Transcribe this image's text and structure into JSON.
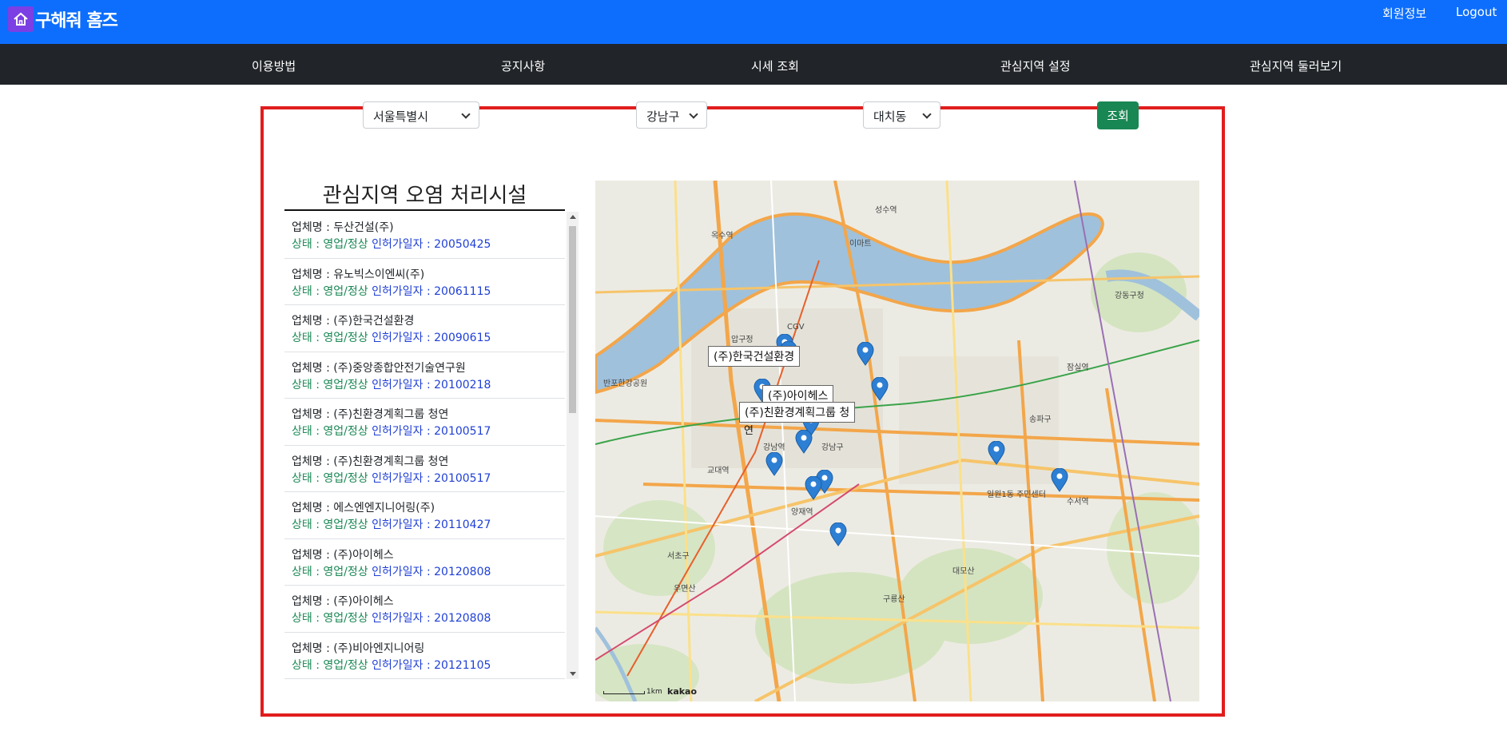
{
  "header": {
    "logo_text": "구해줘 홈즈",
    "member_label": "회원정보",
    "logout_label": "Logout"
  },
  "nav": {
    "items": [
      {
        "label": "이용방법"
      },
      {
        "label": "공지사항"
      },
      {
        "label": "시세 조회"
      },
      {
        "label": "관심지역 설정"
      },
      {
        "label": "관심지역 둘러보기"
      }
    ]
  },
  "filters": {
    "city": "서울특별시",
    "district": "강남구",
    "dong": "대치동",
    "search_label": "조회"
  },
  "list": {
    "title": "관심지역 오염 처리시설",
    "name_prefix": "업체명 : ",
    "status_prefix": "상태 : ",
    "date_prefix": "인허가일자 : ",
    "items": [
      {
        "name": "두산건설(주)",
        "status": "영업/정상",
        "date": "20050425"
      },
      {
        "name": "유노빅스이엔씨(주)",
        "status": "영업/정상",
        "date": "20061115"
      },
      {
        "name": "(주)한국건설환경",
        "status": "영업/정상",
        "date": "20090615"
      },
      {
        "name": "(주)중앙종합안전기술연구원",
        "status": "영업/정상",
        "date": "20100218"
      },
      {
        "name": "(주)친환경계획그룹 청연",
        "status": "영업/정상",
        "date": "20100517"
      },
      {
        "name": "(주)친환경계획그룹 청연",
        "status": "영업/정상",
        "date": "20100517"
      },
      {
        "name": "에스엔엔지니어링(주)",
        "status": "영업/정상",
        "date": "20110427"
      },
      {
        "name": "(주)아이헤스",
        "status": "영업/정상",
        "date": "20120808"
      },
      {
        "name": "(주)아이헤스",
        "status": "영업/정상",
        "date": "20120808"
      },
      {
        "name": "(주)비아엔지니어링",
        "status": "영업/정상",
        "date": "20121105"
      }
    ]
  },
  "map": {
    "info_labels": [
      "(주)한국건설환경",
      "(주)아이헤스",
      "(주)친환경계획그룹 청",
      "연"
    ],
    "place_labels": [
      "CGV",
      "이마트",
      "강남구",
      "서초구",
      "송파구",
      "수서역",
      "양재역",
      "교대역",
      "일원1동 주민센터",
      "구룡산",
      "대모산",
      "우면산",
      "강남역",
      "잠실역",
      "성수역",
      "강동구청",
      "옥수역",
      "압구정",
      "반포한강공원"
    ],
    "scale_label": "1km",
    "brand": "kakao",
    "marker_color": "#2d7fd3"
  },
  "colors": {
    "topbar": "#0d6efd",
    "navbar": "#212529",
    "frame": "#e11d1d",
    "search_button": "#198754",
    "status_text": "#198754",
    "date_text": "#1f3fd6"
  }
}
